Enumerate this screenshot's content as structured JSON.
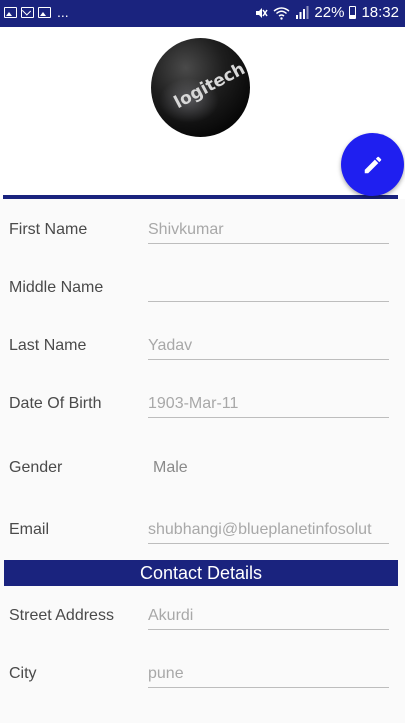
{
  "status_bar": {
    "notification_icons": [
      "image-icon",
      "mail-icon",
      "image-icon"
    ],
    "more": "...",
    "battery_percent": "22%",
    "time": "18:32"
  },
  "profile": {
    "avatar_text": "logitech",
    "edit_icon": "pencil-icon"
  },
  "fields": [
    {
      "label": "First Name",
      "value": "Shivkumar"
    },
    {
      "label": "Middle Name",
      "value": ""
    },
    {
      "label": "Last Name",
      "value": "Yadav"
    },
    {
      "label": "Date Of Birth",
      "value": "1903-Mar-11"
    },
    {
      "label": "Gender",
      "value": "Male"
    },
    {
      "label": "Email",
      "value": "shubhangi@blueplanetinfosolut"
    }
  ],
  "contact_section": {
    "title": "Contact Details",
    "fields": [
      {
        "label": "Street Address",
        "value": "Akurdi"
      },
      {
        "label": "City",
        "value": "pune"
      }
    ]
  },
  "colors": {
    "primary": "#1a237e",
    "fab": "#1f1ff0"
  }
}
